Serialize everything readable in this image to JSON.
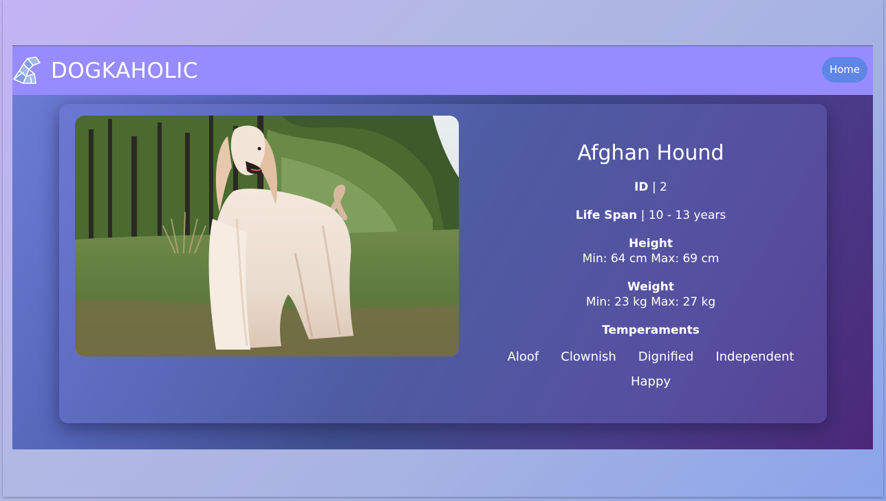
{
  "navbar": {
    "brand": "DOGKAHOLIC",
    "home_label": "Home",
    "logo_icon": "origami-dog-icon"
  },
  "breed": {
    "name": "Afghan Hound",
    "photo_alt": "Afghan Hound",
    "id_label": "ID",
    "id_value": "2",
    "life_span_label": "Life Span",
    "life_span_value": "10 - 13 years",
    "height_label": "Height",
    "height_value": "Min: 64 cm Max: 69 cm",
    "weight_label": "Weight",
    "weight_value": "Min: 23 kg Max: 27 kg",
    "temperaments_label": "Temperaments",
    "temperaments": [
      "Aloof",
      "Clownish",
      "Dignified",
      "Independent",
      "Happy"
    ]
  },
  "colors": {
    "navbar": "#978cfd",
    "home_button": "#5f86e6",
    "text": "#ffffff"
  }
}
